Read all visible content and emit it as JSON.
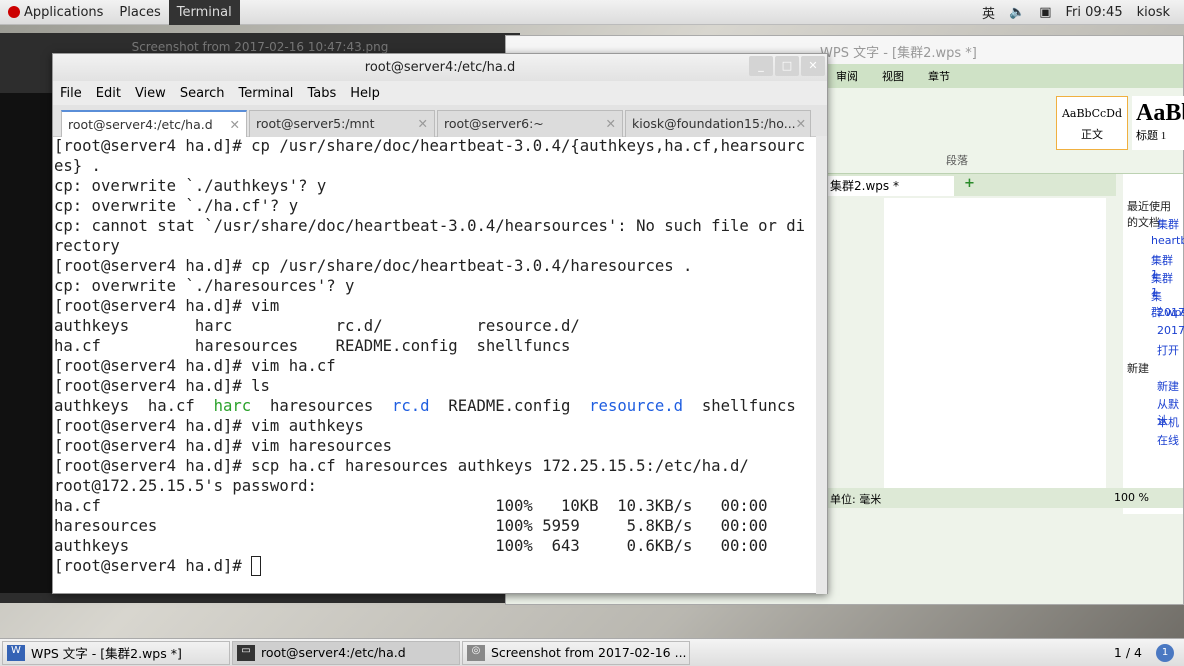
{
  "topbar": {
    "applications": "Applications",
    "places": "Places",
    "terminal": "Terminal",
    "ime": "英",
    "clock": "Fri 09:45",
    "user": "kiosk"
  },
  "bg_windows": {
    "screenshot_title": "Screenshot from 2017-02-16 10:47:43.png",
    "wps_title": "WPS 文字 - [集群2.wps *]",
    "wps_menu": [
      "审阅",
      "视图",
      "章节"
    ],
    "style_normal_preview": "AaBbCcDd",
    "style_normal": "正文",
    "style_h1_preview": "AaBb",
    "style_h1": "标题 1",
    "paragraph_group": "段落",
    "doc_tab": "集群2.wps *",
    "recent_header": "最近使用的文档",
    "recent": [
      "集群",
      "heartbeat",
      "集群1",
      "集群1",
      "集群.wps",
      "2017",
      "2017",
      "打开"
    ],
    "new_header": "新建",
    "new_items": [
      "新建",
      "从默认",
      "本机",
      "在线"
    ],
    "status_unit": "单位: 毫米",
    "zoom": "100 %"
  },
  "terminal": {
    "title": "root@server4:/etc/ha.d",
    "menu": [
      "File",
      "Edit",
      "View",
      "Search",
      "Terminal",
      "Tabs",
      "Help"
    ],
    "tabs": [
      {
        "label": "root@server4:/etc/ha.d",
        "active": true
      },
      {
        "label": "root@server5:/mnt"
      },
      {
        "label": "root@server6:~"
      },
      {
        "label": "kiosk@foundation15:/ho..."
      }
    ],
    "lines": [
      [
        {
          "t": "[root@server4 ha.d]# cp /usr/share/doc/heartbeat-3.0.4/{authkeys,ha.cf,hearsourc"
        }
      ],
      [
        {
          "t": "es} ."
        }
      ],
      [
        {
          "t": "cp: overwrite `./authkeys'? y"
        }
      ],
      [
        {
          "t": "cp: overwrite `./ha.cf'? y"
        }
      ],
      [
        {
          "t": "cp: cannot stat `/usr/share/doc/heartbeat-3.0.4/hearsources': No such file or di"
        }
      ],
      [
        {
          "t": "rectory"
        }
      ],
      [
        {
          "t": "[root@server4 ha.d]# cp /usr/share/doc/heartbeat-3.0.4/haresources ."
        }
      ],
      [
        {
          "t": "cp: overwrite `./haresources'? y"
        }
      ],
      [
        {
          "t": "[root@server4 ha.d]# vim"
        }
      ],
      [
        {
          "t": "authkeys       harc           rc.d/          resource.d/"
        }
      ],
      [
        {
          "t": "ha.cf          haresources    README.config  shellfuncs"
        }
      ],
      [
        {
          "t": "[root@server4 ha.d]# vim ha.cf"
        }
      ],
      [
        {
          "t": "[root@server4 ha.d]# ls"
        }
      ],
      [
        {
          "t": "authkeys  ha.cf  "
        },
        {
          "t": "harc",
          "c": "#2aa12a"
        },
        {
          "t": "  haresources  "
        },
        {
          "t": "rc.d",
          "c": "#1f5ee0"
        },
        {
          "t": "  README.config  "
        },
        {
          "t": "resource.d",
          "c": "#1f5ee0"
        },
        {
          "t": "  shellfuncs"
        }
      ],
      [
        {
          "t": "[root@server4 ha.d]# vim authkeys"
        }
      ],
      [
        {
          "t": "[root@server4 ha.d]# vim haresources"
        }
      ],
      [
        {
          "t": "[root@server4 ha.d]# scp ha.cf haresources authkeys 172.25.15.5:/etc/ha.d/"
        }
      ],
      [
        {
          "t": "root@172.25.15.5's password:"
        }
      ],
      [
        {
          "t": "ha.cf                                          100%   10KB  10.3KB/s   00:00"
        }
      ],
      [
        {
          "t": "haresources                                    100% 5959     5.8KB/s   00:00"
        }
      ],
      [
        {
          "t": "authkeys                                       100%  643     0.6KB/s   00:00"
        }
      ],
      [
        {
          "t": "[root@server4 ha.d]# "
        },
        {
          "cursor": true
        }
      ]
    ]
  },
  "taskbar": {
    "items": [
      "WPS 文字 - [集群2.wps *]",
      "root@server4:/etc/ha.d",
      "Screenshot from 2017-02-16 ..."
    ],
    "pager": "1 / 4"
  }
}
